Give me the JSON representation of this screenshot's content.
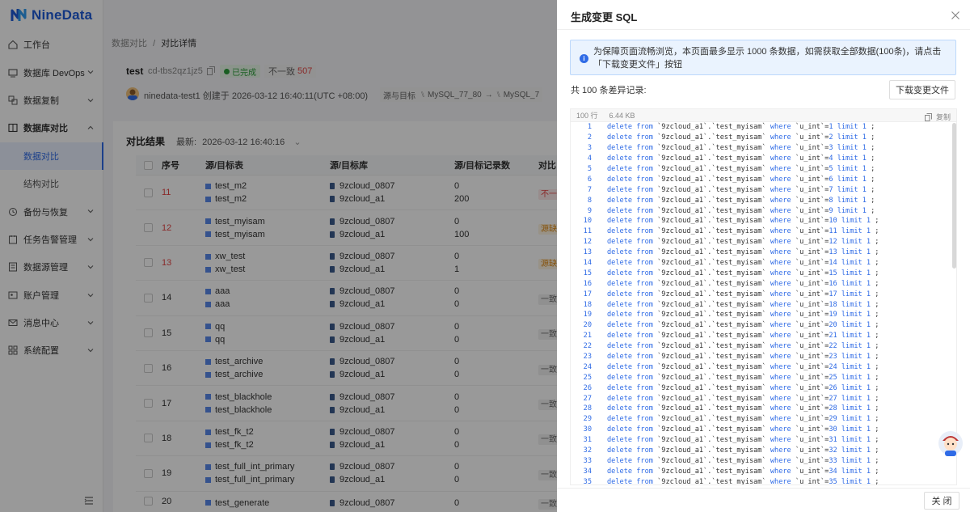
{
  "app": {
    "logo_text": "NineData"
  },
  "sidebar": {
    "items": [
      {
        "label": "工作台",
        "icon": "home-icon",
        "chevron": false
      },
      {
        "label": "数据库 DevOps",
        "icon": "devops-icon",
        "chevron": true
      },
      {
        "label": "数据复制",
        "icon": "replicate-icon",
        "chevron": true
      },
      {
        "label": "数据库对比",
        "icon": "compare-icon",
        "chevron": true,
        "open": true
      },
      {
        "label": "数据对比",
        "sub": true,
        "active": true
      },
      {
        "label": "结构对比",
        "sub": true
      },
      {
        "label": "备份与恢复",
        "icon": "backup-icon",
        "chevron": true
      },
      {
        "label": "任务告警管理",
        "icon": "alarm-icon",
        "chevron": true
      },
      {
        "label": "数据源管理",
        "icon": "datasource-icon",
        "chevron": true
      },
      {
        "label": "账户管理",
        "icon": "account-icon",
        "chevron": true
      },
      {
        "label": "消息中心",
        "icon": "message-icon",
        "chevron": true
      },
      {
        "label": "系统配置",
        "icon": "settings-icon",
        "chevron": true
      }
    ]
  },
  "breadcrumb": {
    "parent": "数据对比",
    "sep": "/",
    "current": "对比详情"
  },
  "task": {
    "name": "test",
    "id": "cd-tbs2qz1jz5",
    "status": "已完成",
    "diff_label": "不一致",
    "diff_count": "507",
    "creator_text": "ninedata-test1 创建于 2026-03-12 16:40:11(UTC +08:00)",
    "route_label": "源与目标",
    "route_source": "MySQL_77_80",
    "route_arrow": "→",
    "route_target": "MySQL_7"
  },
  "results": {
    "title": "对比结果",
    "latest_label": "最新:",
    "latest_time": "2026-03-12 16:40:16",
    "headers": {
      "no": "序号",
      "table": "源/目标表",
      "db": "源/目标库",
      "count": "源/目标记录数",
      "status": "对比"
    },
    "rows": [
      {
        "no": "11",
        "red": true,
        "src_table": "test_m2",
        "dst_table": "test_m2",
        "src_db": "9zcloud_0807",
        "dst_db": "9zcloud_a1",
        "src_cnt": "0",
        "dst_cnt": "200",
        "status": "不一",
        "st": "red"
      },
      {
        "no": "12",
        "red": true,
        "src_table": "test_myisam",
        "dst_table": "test_myisam",
        "src_db": "9zcloud_0807",
        "dst_db": "9zcloud_a1",
        "src_cnt": "0",
        "dst_cnt": "100",
        "status": "源缺",
        "st": "org"
      },
      {
        "no": "13",
        "red": true,
        "src_table": "xw_test",
        "dst_table": "xw_test",
        "src_db": "9zcloud_0807",
        "dst_db": "9zcloud_a1",
        "src_cnt": "0",
        "dst_cnt": "1",
        "status": "源缺",
        "st": "org"
      },
      {
        "no": "14",
        "red": false,
        "src_table": "aaa",
        "dst_table": "aaa",
        "src_db": "9zcloud_0807",
        "dst_db": "9zcloud_a1",
        "src_cnt": "0",
        "dst_cnt": "0",
        "status": "一致",
        "st": "gray"
      },
      {
        "no": "15",
        "red": false,
        "src_table": "qq",
        "dst_table": "qq",
        "src_db": "9zcloud_0807",
        "dst_db": "9zcloud_a1",
        "src_cnt": "0",
        "dst_cnt": "0",
        "status": "一致",
        "st": "gray"
      },
      {
        "no": "16",
        "red": false,
        "src_table": "test_archive",
        "dst_table": "test_archive",
        "src_db": "9zcloud_0807",
        "dst_db": "9zcloud_a1",
        "src_cnt": "0",
        "dst_cnt": "0",
        "status": "一致",
        "st": "gray"
      },
      {
        "no": "17",
        "red": false,
        "src_table": "test_blackhole",
        "dst_table": "test_blackhole",
        "src_db": "9zcloud_0807",
        "dst_db": "9zcloud_a1",
        "src_cnt": "0",
        "dst_cnt": "0",
        "status": "一致",
        "st": "gray"
      },
      {
        "no": "18",
        "red": false,
        "src_table": "test_fk_t2",
        "dst_table": "test_fk_t2",
        "src_db": "9zcloud_0807",
        "dst_db": "9zcloud_a1",
        "src_cnt": "0",
        "dst_cnt": "0",
        "status": "一致",
        "st": "gray"
      },
      {
        "no": "19",
        "red": false,
        "src_table": "test_full_int_primary",
        "dst_table": "test_full_int_primary",
        "src_db": "9zcloud_0807",
        "dst_db": "9zcloud_a1",
        "src_cnt": "0",
        "dst_cnt": "0",
        "status": "一致",
        "st": "gray"
      },
      {
        "no": "20",
        "red": false,
        "src_table": "test_generate",
        "dst_table": "",
        "src_db": "9zcloud_0807",
        "dst_db": "",
        "src_cnt": "0",
        "dst_cnt": "",
        "status": "一致",
        "st": "gray"
      }
    ]
  },
  "drawer": {
    "title": "生成变更 SQL",
    "notice": "为保障页面流畅浏览，本页面最多显示 1000 条数据，如需获取全部数据(100条)，请点击「下载变更文件」按钮",
    "count_text": "共 100 条差异记录:",
    "download_label": "下载变更文件",
    "code_lines": "100 行",
    "code_size": "6.44 KB",
    "copy_label": "复制",
    "close_label": "关 闭",
    "sql": {
      "kw_delete": "delete",
      "kw_from": "from",
      "table_ref": "`9zcloud_a1`.`test_myisam`",
      "kw_where": "where",
      "column": "`u_int`",
      "kw_limit": "limit",
      "limit_val": "1",
      "terminator": ";",
      "ids": [
        "1",
        "2",
        "3",
        "4",
        "5",
        "6",
        "7",
        "8",
        "9",
        "10",
        "11",
        "12",
        "13",
        "14",
        "15",
        "16",
        "17",
        "18",
        "19",
        "20",
        "21",
        "22",
        "23",
        "24",
        "25",
        "26",
        "27",
        "28",
        "29",
        "30",
        "31",
        "32",
        "33",
        "34",
        "35"
      ]
    }
  }
}
